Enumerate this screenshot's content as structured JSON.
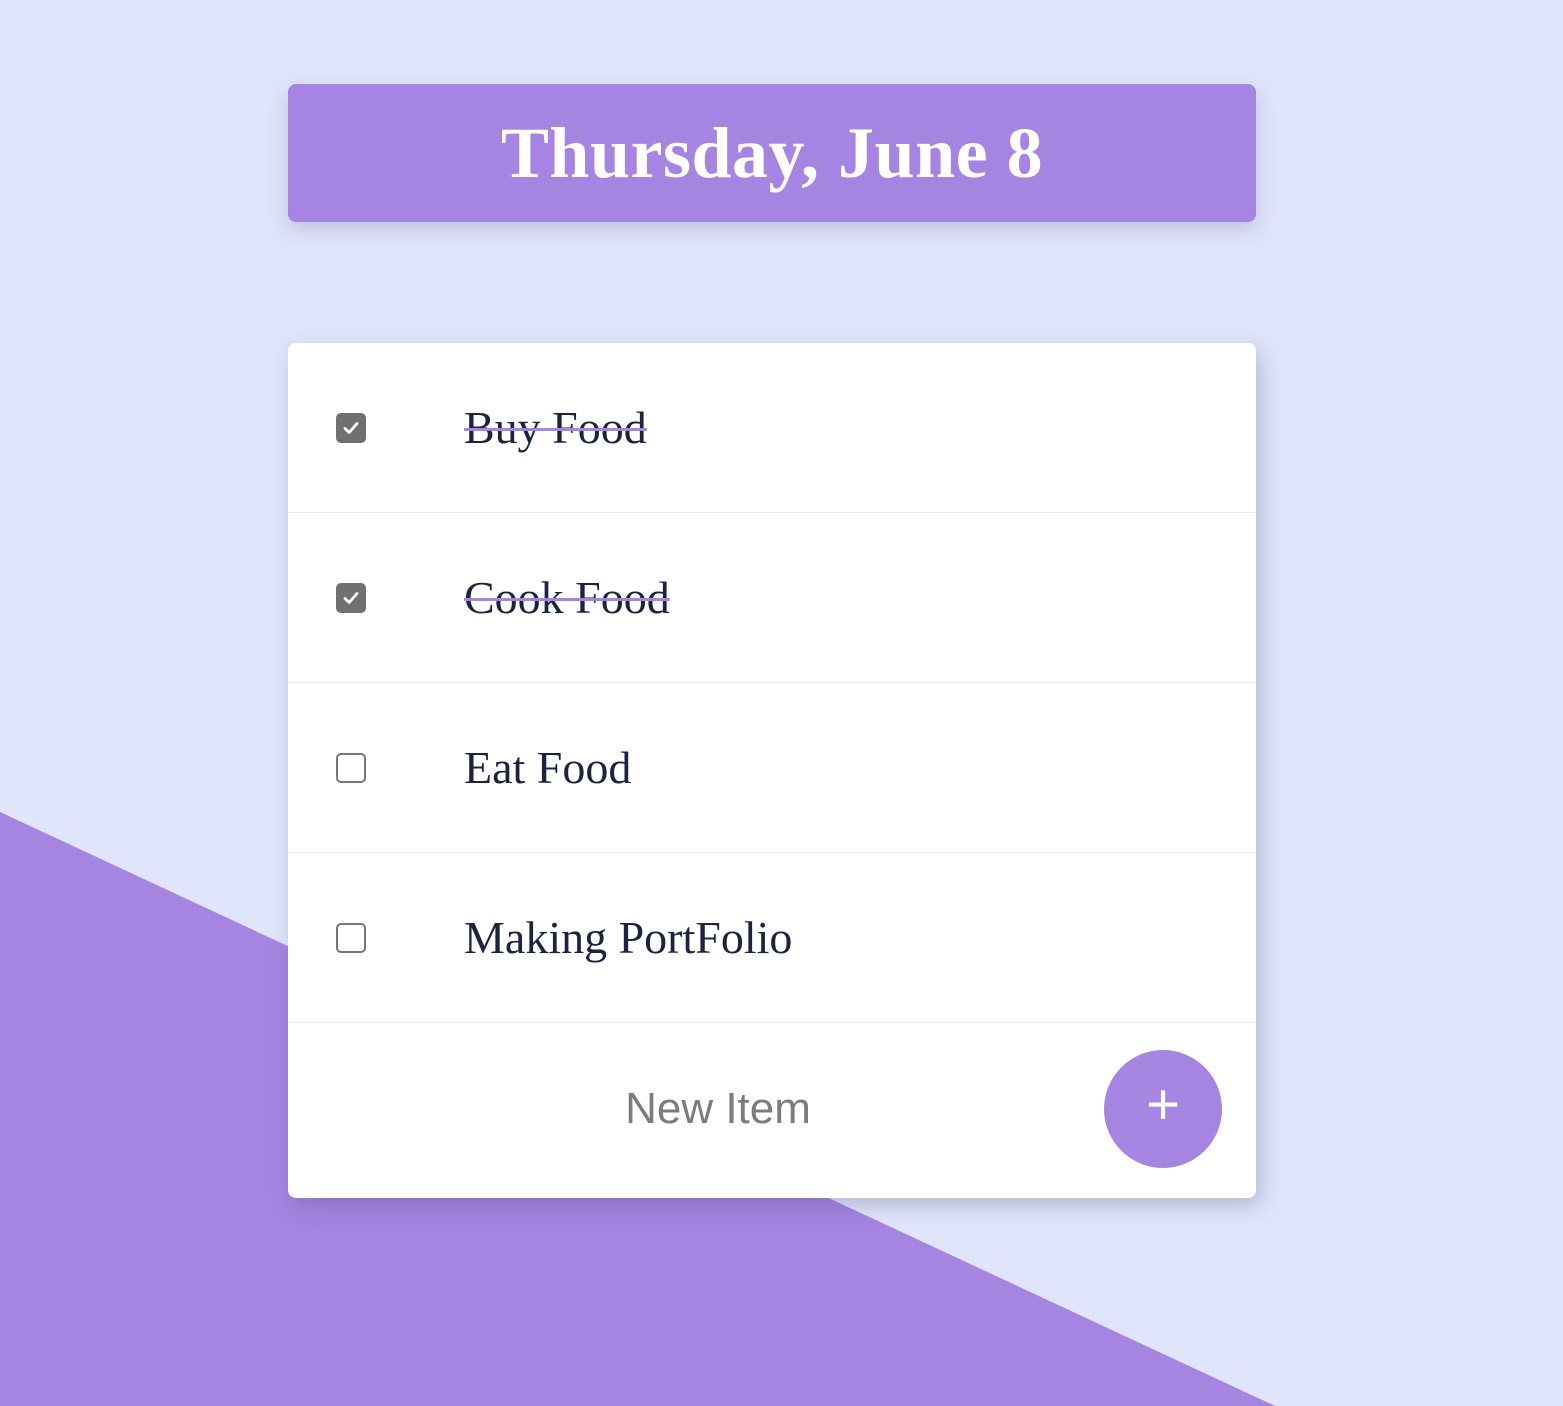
{
  "header": {
    "date_title": "Thursday, June 8"
  },
  "todo_list": {
    "items": [
      {
        "label": "Buy Food",
        "checked": true
      },
      {
        "label": "Cook Food",
        "checked": true
      },
      {
        "label": "Eat Food",
        "checked": false
      },
      {
        "label": "Making PortFolio",
        "checked": false
      }
    ]
  },
  "new_item": {
    "placeholder": "New Item",
    "value": "",
    "add_button_label": "+"
  },
  "colors": {
    "background": "#E1E5FB",
    "accent": "#A684E2",
    "card": "#FFFFFF",
    "text": "#1C2340"
  }
}
